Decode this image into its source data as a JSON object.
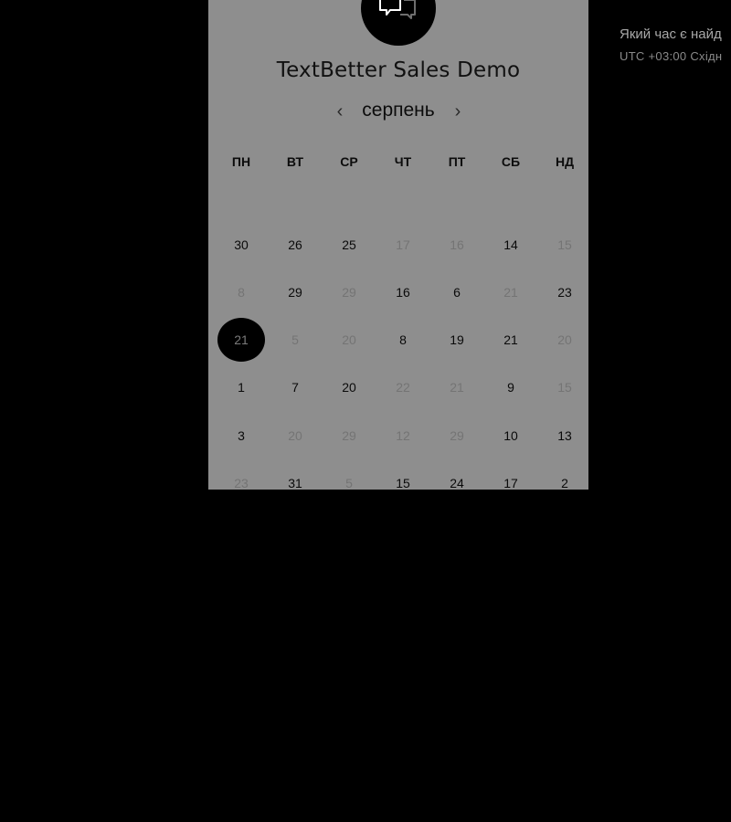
{
  "event": {
    "title": "TextBetter Sales Demo"
  },
  "calendar": {
    "month": "серпень",
    "prev_icon": "chevron-left-icon",
    "next_icon": "chevron-right-icon",
    "weekdays": [
      "ПН",
      "ВТ",
      "СР",
      "ЧТ",
      "ПТ",
      "СБ",
      "НД"
    ],
    "rows": [
      [
        {
          "t": "30",
          "a": true
        },
        {
          "t": "26",
          "a": true
        },
        {
          "t": "25",
          "a": true
        },
        {
          "t": "17",
          "a": false
        },
        {
          "t": "16",
          "a": false
        },
        {
          "t": "14",
          "a": true
        },
        {
          "t": "15",
          "a": false
        }
      ],
      [
        {
          "t": "8",
          "a": false
        },
        {
          "t": "29",
          "a": true
        },
        {
          "t": "29",
          "a": false
        },
        {
          "t": "16",
          "a": true
        },
        {
          "t": "6",
          "a": true
        },
        {
          "t": "21",
          "a": false
        },
        {
          "t": "23",
          "a": true
        }
      ],
      [
        {
          "t": "21",
          "a": false,
          "sel": true
        },
        {
          "t": "5",
          "a": false
        },
        {
          "t": "20",
          "a": false
        },
        {
          "t": "8",
          "a": true
        },
        {
          "t": "19",
          "a": true
        },
        {
          "t": "21",
          "a": true
        },
        {
          "t": "20",
          "a": false
        }
      ],
      [
        {
          "t": "1",
          "a": true
        },
        {
          "t": "7",
          "a": true
        },
        {
          "t": "20",
          "a": true
        },
        {
          "t": "22",
          "a": false
        },
        {
          "t": "21",
          "a": false
        },
        {
          "t": "9",
          "a": true
        },
        {
          "t": "15",
          "a": false
        }
      ],
      [
        {
          "t": "3",
          "a": true
        },
        {
          "t": "20",
          "a": false
        },
        {
          "t": "29",
          "a": false
        },
        {
          "t": "12",
          "a": false
        },
        {
          "t": "29",
          "a": false
        },
        {
          "t": "10",
          "a": true
        },
        {
          "t": "13",
          "a": true
        }
      ],
      [
        {
          "t": "23",
          "a": false
        },
        {
          "t": "31",
          "a": true
        },
        {
          "t": "5",
          "a": false
        },
        {
          "t": "15",
          "a": true
        },
        {
          "t": "24",
          "a": true
        },
        {
          "t": "17",
          "a": true
        },
        {
          "t": "2",
          "a": true
        }
      ]
    ]
  },
  "sidebar": {
    "question": "Який час є найд",
    "timezone": "UTC +03:00 Східн"
  },
  "colors": {
    "page_background": "#000000",
    "panel_background": "#8e8e8e",
    "selected_day": "#000000",
    "text_dark": "#0c0c0c",
    "text_dim": "#747474"
  }
}
